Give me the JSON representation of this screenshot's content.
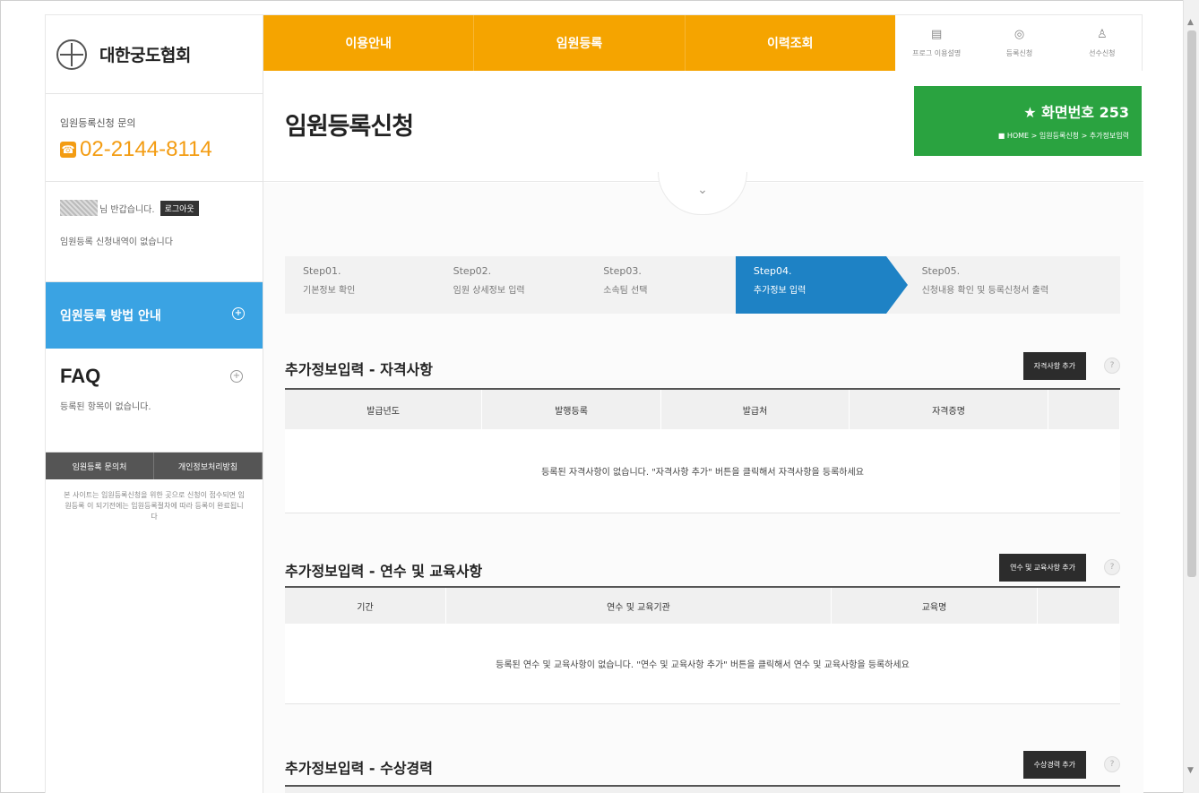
{
  "sidebar": {
    "logo_text": "대한궁도협회",
    "contact_label": "임원등록신청 문의",
    "contact_phone": "02-2144-8114",
    "welcome_text": "님 반갑습니다.",
    "logout_label": "로그아웃",
    "no_apply_text": "임원등록 신청내역이 없습니다",
    "method_label": "임원등록 방법 안내",
    "faq_title": "FAQ",
    "faq_sub": "등록된 항목이 없습니다.",
    "dark_btn_1": "임원등록 문의처",
    "dark_btn_2": "개인정보처리방침",
    "side_note": "본 사이트는 임원등록신청을 위한 곳으로 신청이 접수되면 임원등록 이 되기전에는 임원등록절차에 따라 등록이 완료됩니다"
  },
  "topnav": {
    "items": [
      "이용안내",
      "임원등록",
      "이력조회"
    ]
  },
  "util": {
    "items": [
      {
        "label": "프로그 이용설명",
        "icon": "document-icon"
      },
      {
        "label": "등록신청",
        "icon": "target-icon"
      },
      {
        "label": "선수신청",
        "icon": "person-icon"
      }
    ]
  },
  "content": {
    "page_title": "임원등록신청",
    "screen_no": "★  화면번호 253",
    "breadcrumb": "■ HOME > 임원등록신청 > 추가정보입력"
  },
  "steps": [
    {
      "num": "Step01.",
      "label": "기본정보 확인"
    },
    {
      "num": "Step02.",
      "label": "임원 상세정보 입력"
    },
    {
      "num": "Step03.",
      "label": "소속팀 선택"
    },
    {
      "num": "Step04.",
      "label": "추가정보 입력"
    },
    {
      "num": "Step05.",
      "label": "신청내용 확인 및 등록신청서 출력"
    }
  ],
  "sections": {
    "qual": {
      "title": "추가정보입력 - 자격사항",
      "button": "자격사항 추가",
      "headers": [
        "발급년도",
        "발행등록",
        "발급처",
        "자격증명"
      ],
      "empty": "등록된 자격사항이 없습니다. \"자격사항 추가\" 버튼을 클릭해서 자격사항을 등록하세요"
    },
    "edu": {
      "title": "추가정보입력 - 연수 및 교육사항",
      "button": "연수 및 교육사항 추가",
      "headers": [
        "기간",
        "연수 및 교육기관",
        "교육명"
      ],
      "empty": "등록된 연수 및 교육사항이 없습니다. \"연수 및 교육사항 추가\" 버튼을 클릭해서 연수 및 교육사항을 등록하세요"
    },
    "award": {
      "title": "추가정보입력 - 수상경력",
      "button": "수상경력 추가"
    }
  }
}
